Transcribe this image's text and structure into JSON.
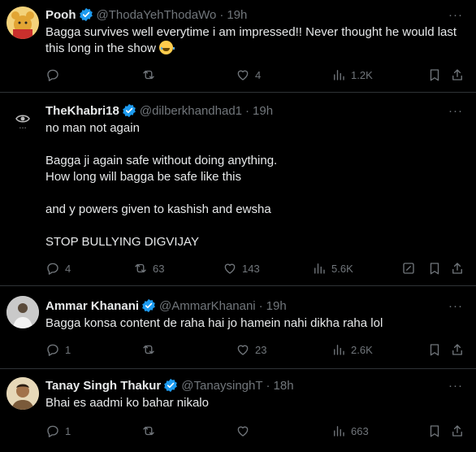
{
  "colors": {
    "background": "#000000",
    "divider": "#2f3336",
    "primary_text": "#e7e9ea",
    "secondary_text": "#71767b",
    "verified_blue": "#1d9bf0"
  },
  "tweets": [
    {
      "name": "Pooh",
      "handle": "@ThodaYehThodaWo",
      "time": "19h",
      "lines": [
        "Bagga survives well everytime i am impressed!! Never thought he would last",
        "this long in the show"
      ],
      "emoji": "joy-emoji",
      "replies": "",
      "reposts": "",
      "likes": "4",
      "views": "1.2K"
    },
    {
      "name": "TheKhabri18",
      "handle": "@dilberkhandhad1",
      "time": "19h",
      "lines": [
        "no man not again",
        "",
        "Bagga ji again safe without doing anything.",
        "How long will bagga be safe like this",
        "",
        "and y powers given to kashish and ewsha",
        "",
        "STOP BULLYING DIGVIJAY"
      ],
      "replies": "4",
      "reposts": "63",
      "likes": "143",
      "views": "5.6K"
    },
    {
      "name": "Ammar Khanani",
      "handle": "@AmmarKhanani",
      "time": "19h",
      "lines": [
        "Bagga konsa content de raha hai jo hamein nahi dikha raha lol"
      ],
      "replies": "1",
      "reposts": "",
      "likes": "23",
      "views": "2.6K"
    },
    {
      "name": "Tanay Singh Thakur",
      "handle": "@TanaysinghT",
      "time": "18h",
      "lines": [
        "Bhai es aadmi ko bahar nikalo"
      ],
      "replies": "1",
      "reposts": "",
      "likes": "",
      "views": "663"
    }
  ],
  "icons": {
    "reply": "reply-icon",
    "repost": "repost-icon",
    "like": "like-icon",
    "views": "views-icon",
    "bookmark": "bookmark-icon",
    "share": "share-icon",
    "edit": "edit-icon",
    "more": "more-icon",
    "verified": "verified-badge-icon"
  }
}
